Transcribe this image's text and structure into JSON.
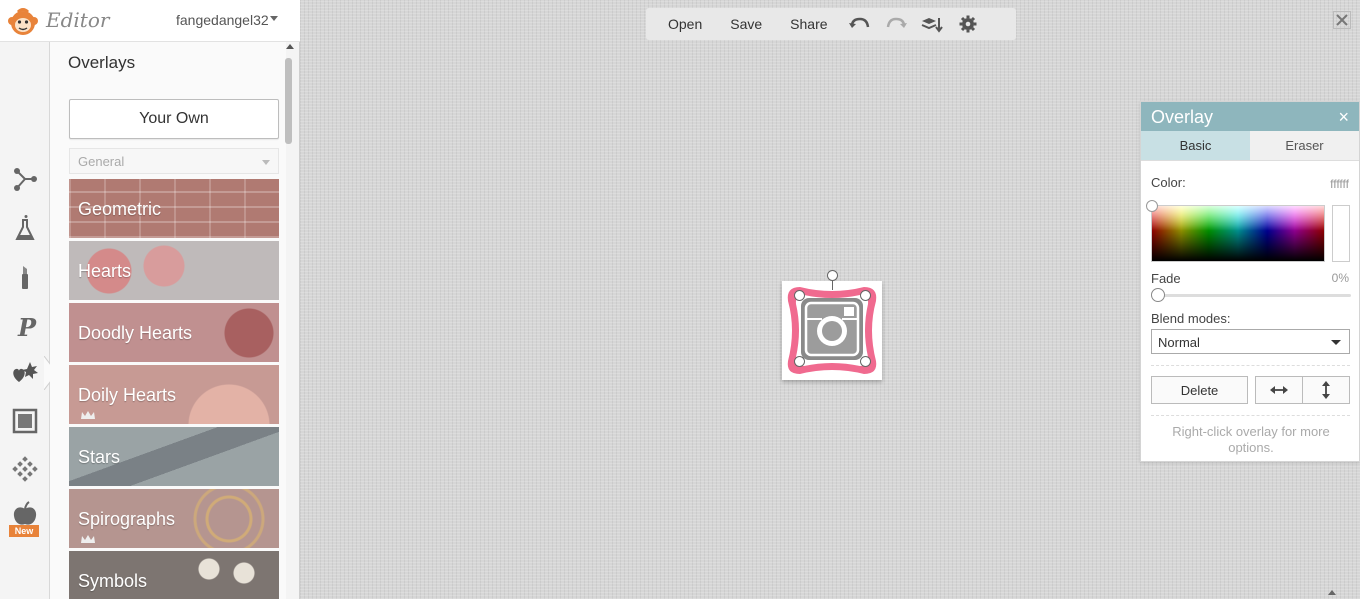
{
  "app": {
    "logo_text": "Editor",
    "username": "fangedangel32"
  },
  "panel": {
    "title": "Overlays",
    "your_own_label": "Your Own",
    "category": "General",
    "tiles": [
      {
        "label": "Geometric"
      },
      {
        "label": "Hearts"
      },
      {
        "label": "Doodly Hearts"
      },
      {
        "label": "Doily Hearts"
      },
      {
        "label": "Stars"
      },
      {
        "label": "Spirographs"
      },
      {
        "label": "Symbols"
      }
    ]
  },
  "tools": [
    {
      "icon": "effects-icon"
    },
    {
      "icon": "flask-icon"
    },
    {
      "icon": "touch-up-icon"
    },
    {
      "icon": "text-icon"
    },
    {
      "icon": "overlays-icon"
    },
    {
      "icon": "frames-icon"
    },
    {
      "icon": "textures-icon"
    },
    {
      "icon": "seasonal-icon",
      "badge": "New"
    }
  ],
  "toolbar": {
    "open": "Open",
    "save": "Save",
    "share": "Share"
  },
  "props": {
    "title": "Overlay",
    "close": "×",
    "tab_basic": "Basic",
    "tab_eraser": "Eraser",
    "color_label": "Color:",
    "color_value": "ffffff",
    "fade_label": "Fade",
    "fade_value": "0%",
    "blend_label": "Blend modes:",
    "blend_value": "Normal",
    "delete_label": "Delete",
    "hint": "Right-click overlay for more options."
  },
  "colors": {
    "accent": "#8eb6bd",
    "overlay_pink": "#f06a8f"
  }
}
